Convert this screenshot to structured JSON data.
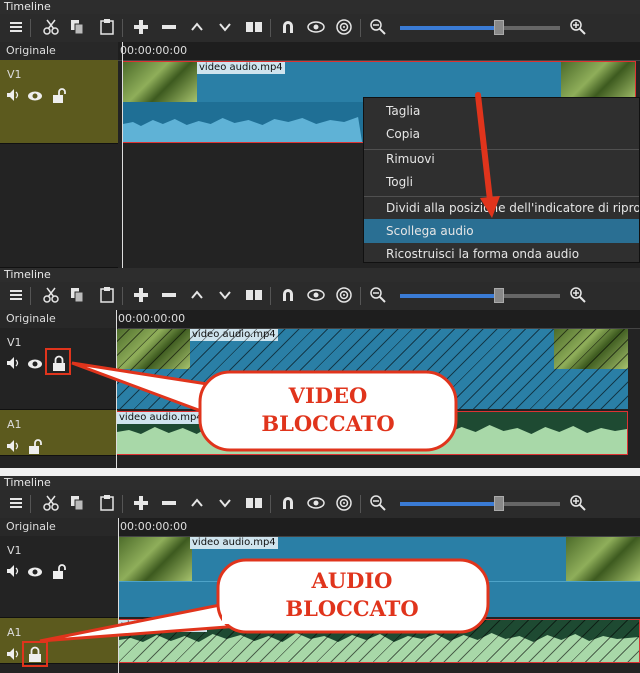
{
  "timeline_title": "Timeline",
  "originale": "Originale",
  "timecode": "00:00:00:00",
  "tracks": {
    "v1": "V1",
    "a1": "A1"
  },
  "clip_name": "video audio.mp4",
  "context_menu": {
    "items": [
      "Taglia",
      "Copia",
      "Rimuovi",
      "Togli",
      "Dividi alla posizione dell'indicatore di riproduz",
      "Scollega audio",
      "Ricostruisci la forma onda audio"
    ],
    "highlighted": "Scollega audio"
  },
  "callouts": {
    "video": [
      "VIDEO",
      "BLOCCATO"
    ],
    "audio": [
      "AUDIO",
      "BLOCCATO"
    ]
  },
  "toolbar_icons": [
    "menu-icon",
    "cut-icon",
    "copy-icon",
    "paste-icon",
    "add-icon",
    "remove-icon",
    "up-icon",
    "down-icon",
    "timeline-icon",
    "snap-magnet-icon",
    "eye-icon",
    "target-icon",
    "zoom-out-icon",
    "zoom-in-icon"
  ],
  "zoom_level_fraction": 0.63,
  "colors": {
    "track_selected": "#5c5a1e",
    "clip_blue": "#2a7fa6",
    "audio_green": "#a8d8a8",
    "accent_red": "#e0341c",
    "menu_highlight": "#2a6f93"
  }
}
